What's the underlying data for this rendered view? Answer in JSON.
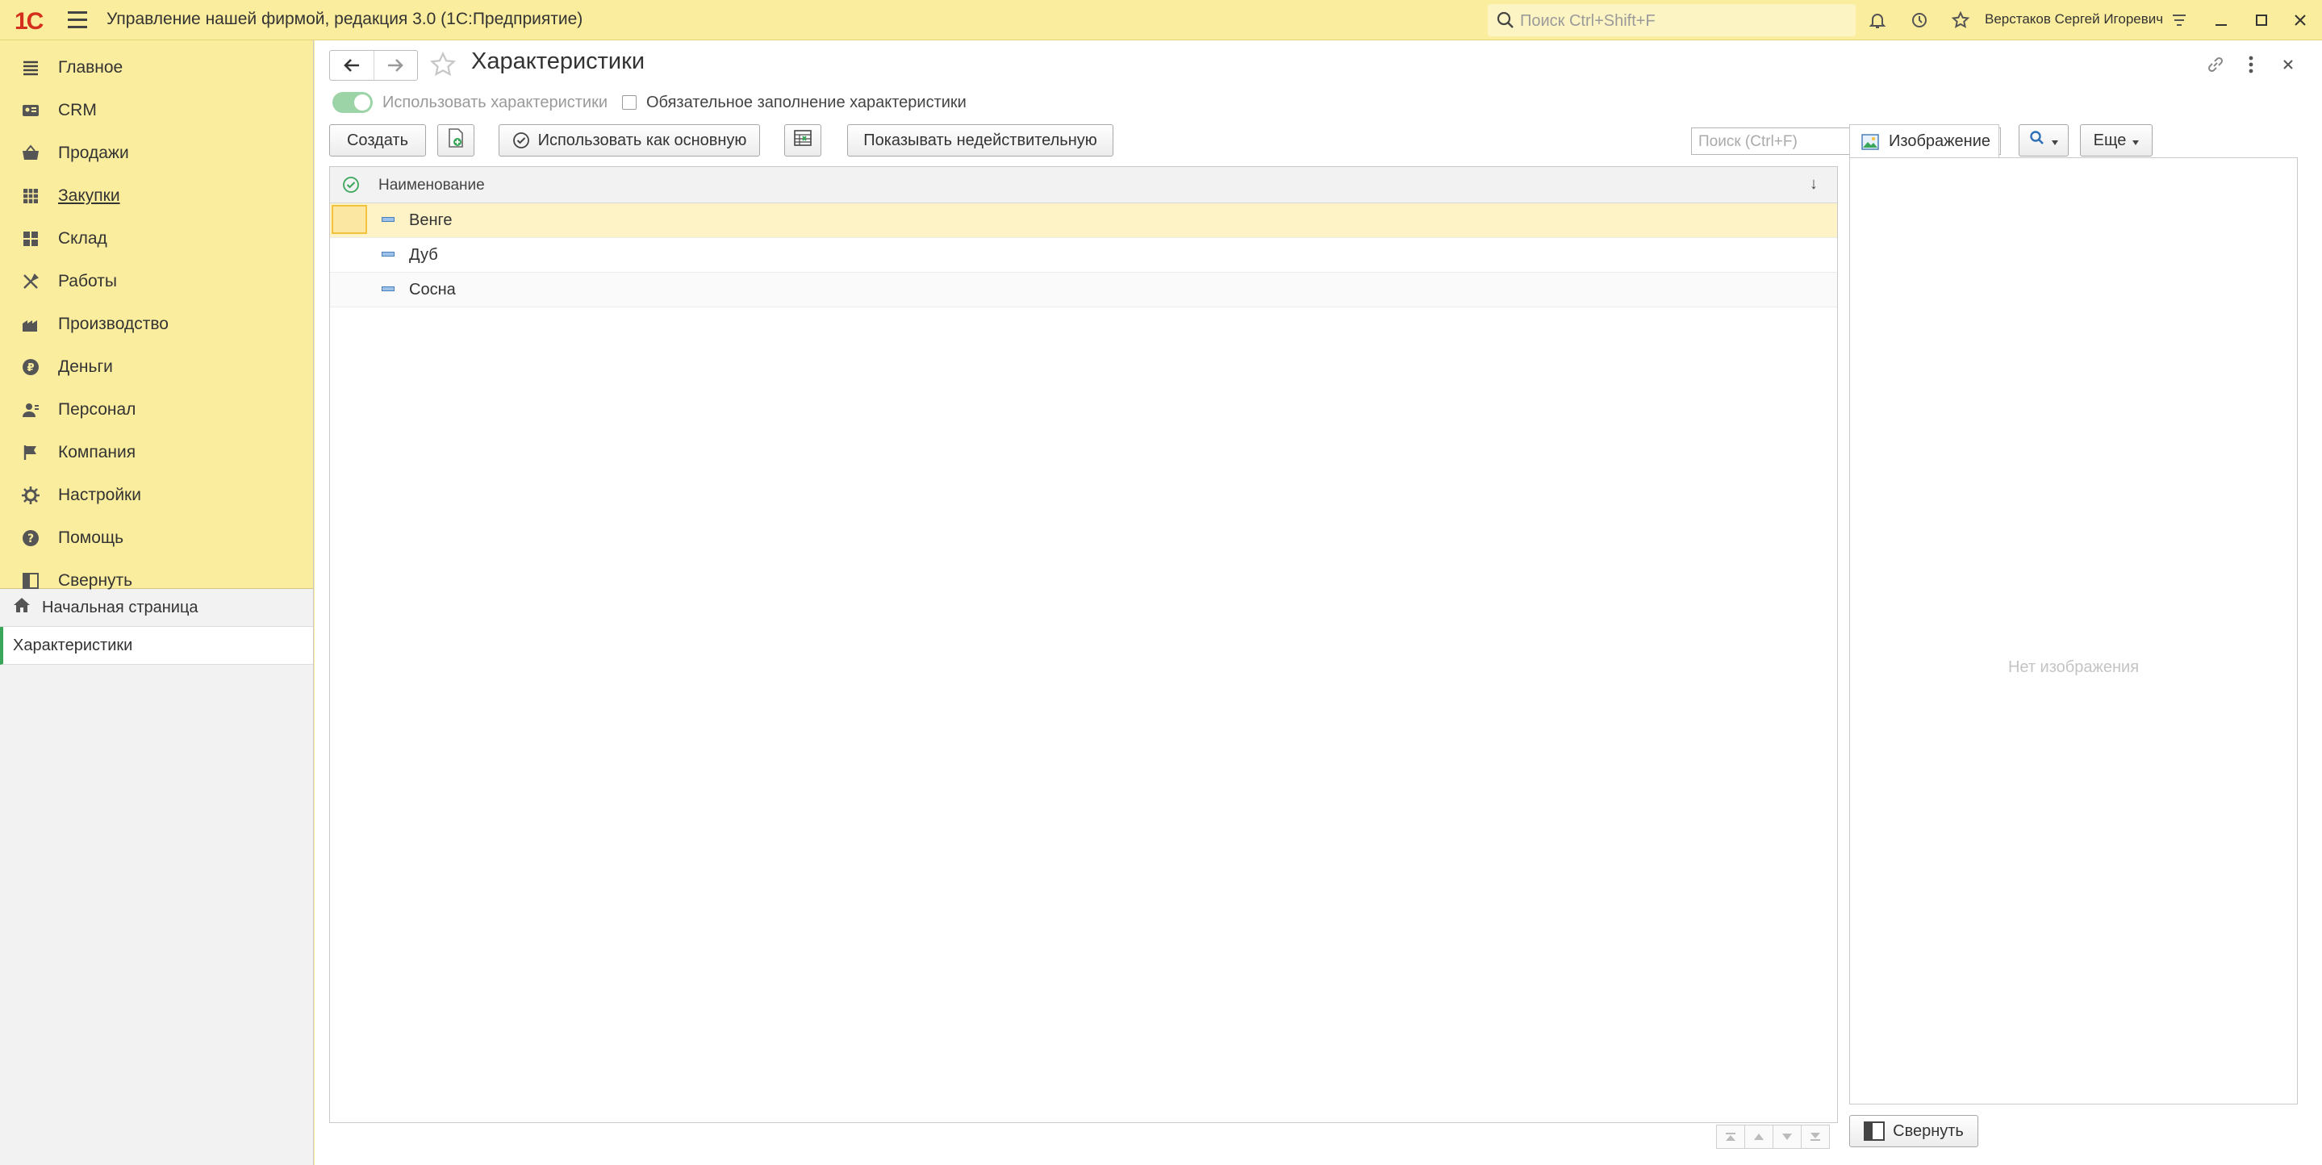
{
  "app": {
    "logo_text": "1С",
    "title": "Управление нашей фирмой, редакция 3.0  (1С:Предприятие)",
    "search_placeholder": "Поиск Ctrl+Shift+F",
    "user": "Верстаков Сергей Игоревич"
  },
  "sidebar": {
    "sections": [
      {
        "label": "Главное",
        "icon": "menu-list-icon"
      },
      {
        "label": "CRM",
        "icon": "crm-icon"
      },
      {
        "label": "Продажи",
        "icon": "sales-basket-icon"
      },
      {
        "label": "Закупки",
        "icon": "purchases-icon"
      },
      {
        "label": "Склад",
        "icon": "warehouse-icon"
      },
      {
        "label": "Работы",
        "icon": "tools-icon"
      },
      {
        "label": "Производство",
        "icon": "production-icon"
      },
      {
        "label": "Деньги",
        "icon": "money-icon"
      },
      {
        "label": "Персонал",
        "icon": "staff-icon"
      },
      {
        "label": "Компания",
        "icon": "flag-icon"
      },
      {
        "label": "Настройки",
        "icon": "gear-icon"
      },
      {
        "label": "Помощь",
        "icon": "help-icon"
      },
      {
        "label": "Свернуть",
        "icon": "collapse-panel-icon"
      }
    ],
    "open_windows": [
      {
        "label": "Начальная страница",
        "icon": "home-icon"
      },
      {
        "label": "Характеристики"
      }
    ]
  },
  "form": {
    "title": "Характеристики",
    "use_characteristics_label": "Использовать характеристики",
    "required_fill_label": "Обязательное заполнение характеристики",
    "buttons": {
      "create": "Создать",
      "use_as_main": "Использовать как основную",
      "show_invalid": "Показывать недействительную",
      "more": "Еще"
    },
    "search_placeholder": "Поиск (Ctrl+F)",
    "search_clear": "×",
    "table": {
      "column_name": "Наименование",
      "sort_indicator": "↓",
      "rows": [
        "Венге",
        "Дуб",
        "Сосна"
      ]
    },
    "image_panel": {
      "tab_label": "Изображение",
      "empty_text": "Нет изображения",
      "collapse_label": "Свернуть"
    }
  },
  "colors": {
    "accent_yellow": "#fbed9e",
    "selection_yellow": "#fdf3c7",
    "toggle_green": "#9cd3a7",
    "logo_red": "#d32f1c"
  }
}
